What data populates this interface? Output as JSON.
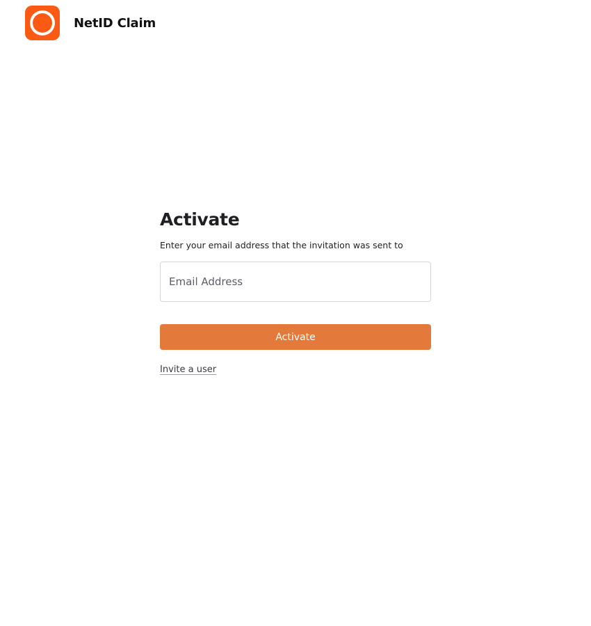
{
  "header": {
    "logo_icon": "netid-logo-icon",
    "title": "NetID Claim"
  },
  "form": {
    "heading": "Activate",
    "subtitle": "Enter your email address that the invitation was sent to",
    "email_placeholder": "Email Address",
    "email_value": "",
    "submit_label": "Activate",
    "invite_link": "Invite a user"
  },
  "colors": {
    "brand": "#fa5a14",
    "button": "#e37a3b"
  }
}
